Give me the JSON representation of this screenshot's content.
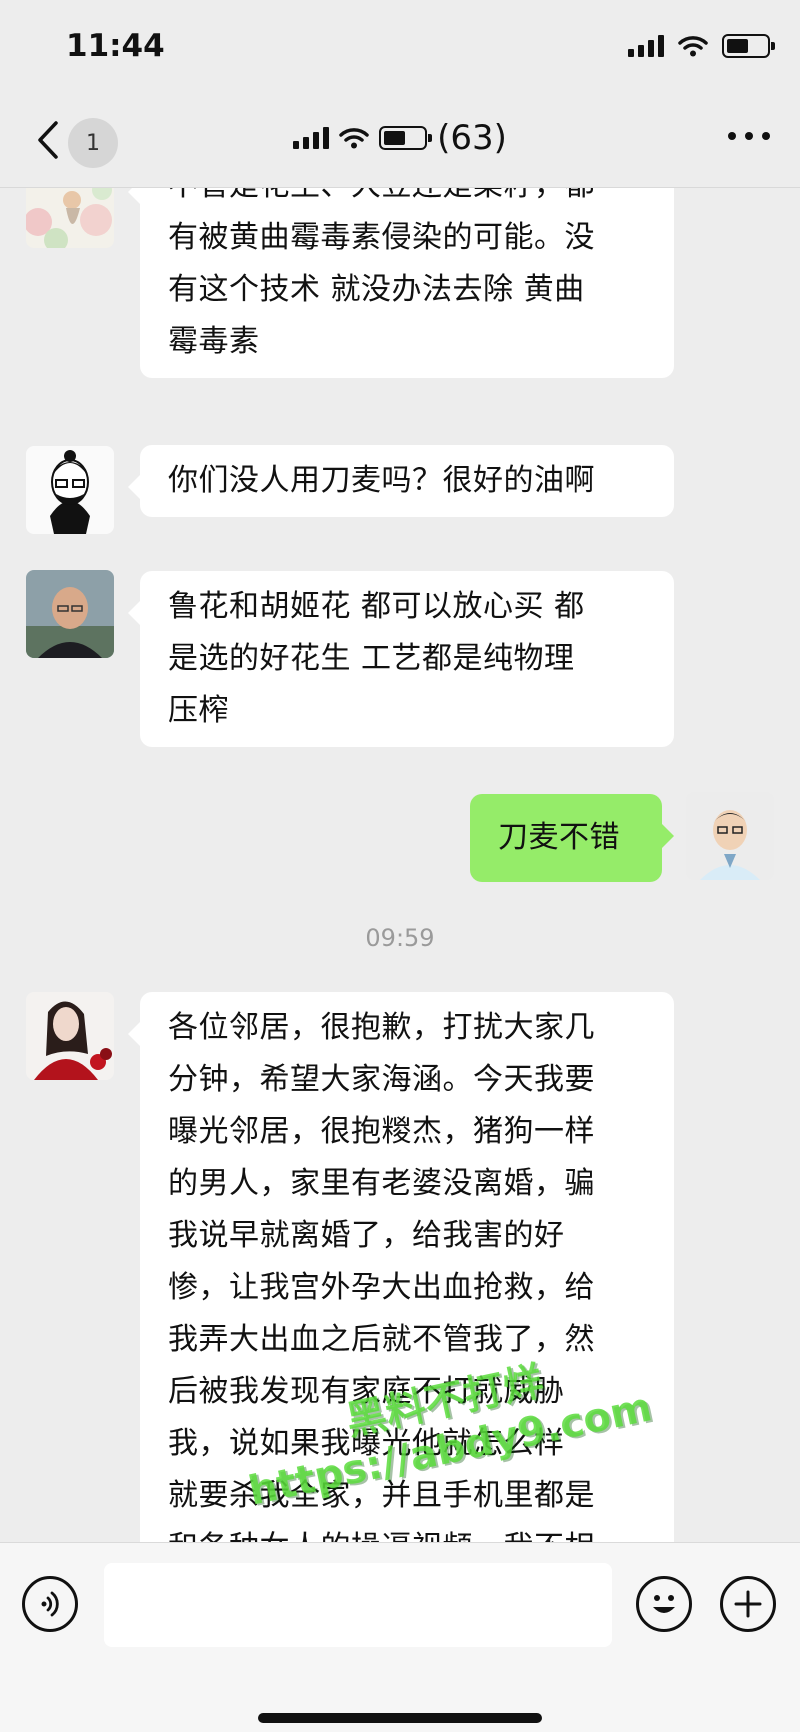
{
  "status_bar": {
    "time": "11:44"
  },
  "nav": {
    "unread_count": "1",
    "member_count": "(63)"
  },
  "messages": [
    {
      "side": "left",
      "avatar": "flower-girl-avatar",
      "text": "不管是花生、大豆还是菜籽，都\n有被黄曲霉毒素侵染的可能。没\n有这个技术 就没办法去除 黄曲\n霉毒素"
    },
    {
      "side": "left",
      "avatar": "sketch-man-avatar",
      "text": "你们没人用刀麦吗？很好的油啊"
    },
    {
      "side": "left",
      "avatar": "bald-man-avatar",
      "text": "鲁花和胡姬花 都可以放心买 都\n是选的好花生 工艺都是纯物理\n压榨"
    },
    {
      "side": "right",
      "avatar": "cartoon-man-avatar",
      "text": "刀麦不错"
    },
    {
      "side": "center",
      "text": "09:59"
    },
    {
      "side": "left",
      "avatar": "red-dress-woman-avatar",
      "text": "各位邻居，很抱歉，打扰大家几\n分钟，希望大家海涵。今天我要\n曝光邻居，很抱糉杰，猪狗一样\n的男人，家里有老婆没离婚，骗\n我说早就离婚了，给我害的好\n惨，让我宫外孕大出血抢救，给\n我弄大出血之后就不管我了，然\n后被我发现有家庭不打就威胁\n我，说如果我曝光他就怎么样\n就要杀我全家，并且手机里都是\n和各种女人的操逼视频，我不相"
    }
  ],
  "watermark": {
    "line1": "黑料不打烊",
    "line2": "https://abdy9.com"
  },
  "input_bar": {
    "placeholder": ""
  },
  "colors": {
    "background": "#ededed",
    "bubble_left": "#ffffff",
    "bubble_right": "#95ec69",
    "watermark": "#5adc3c"
  }
}
